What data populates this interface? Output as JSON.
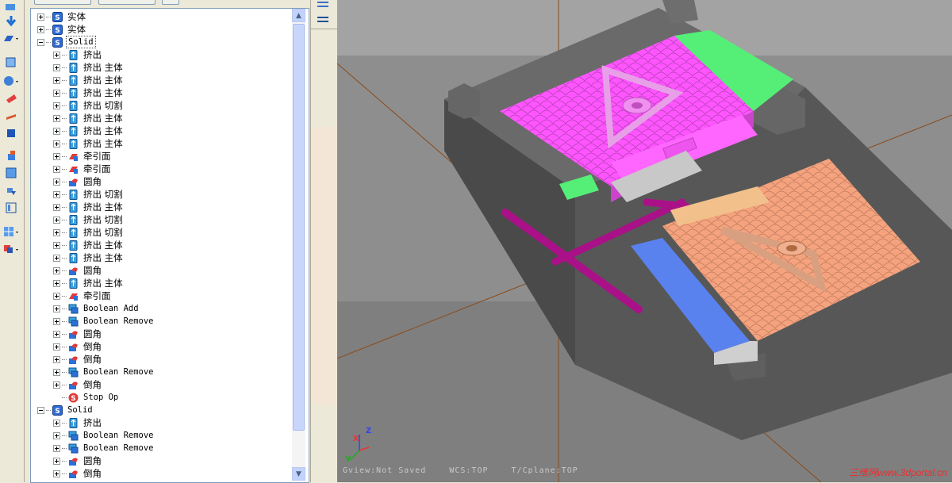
{
  "tree": {
    "items": [
      {
        "label": "实体",
        "kind": "solid",
        "level": 0,
        "expander": "plus"
      },
      {
        "label": "实体",
        "kind": "solid",
        "level": 0,
        "expander": "plus"
      },
      {
        "label": "Solid",
        "kind": "solid",
        "level": 0,
        "expander": "minus",
        "selected": true,
        "mono": true
      },
      {
        "label": "挤出",
        "kind": "extrude",
        "level": 1,
        "expander": "plus"
      },
      {
        "label": "挤出 主体",
        "kind": "extrude",
        "level": 1,
        "expander": "plus"
      },
      {
        "label": "挤出 主体",
        "kind": "extrude",
        "level": 1,
        "expander": "plus"
      },
      {
        "label": "挤出 主体",
        "kind": "extrude",
        "level": 1,
        "expander": "plus"
      },
      {
        "label": "挤出 切割",
        "kind": "extrude",
        "level": 1,
        "expander": "plus"
      },
      {
        "label": "挤出 主体",
        "kind": "extrude",
        "level": 1,
        "expander": "plus"
      },
      {
        "label": "挤出 主体",
        "kind": "extrude",
        "level": 1,
        "expander": "plus"
      },
      {
        "label": "挤出 主体",
        "kind": "extrude",
        "level": 1,
        "expander": "plus"
      },
      {
        "label": "牵引面",
        "kind": "draft",
        "level": 1,
        "expander": "plus"
      },
      {
        "label": "牵引面",
        "kind": "draft",
        "level": 1,
        "expander": "plus"
      },
      {
        "label": "圆角",
        "kind": "fillet",
        "level": 1,
        "expander": "plus"
      },
      {
        "label": "挤出 切割",
        "kind": "extrude",
        "level": 1,
        "expander": "plus"
      },
      {
        "label": "挤出 主体",
        "kind": "extrude",
        "level": 1,
        "expander": "plus"
      },
      {
        "label": "挤出 切割",
        "kind": "extrude",
        "level": 1,
        "expander": "plus"
      },
      {
        "label": "挤出 切割",
        "kind": "extrude",
        "level": 1,
        "expander": "plus"
      },
      {
        "label": "挤出 主体",
        "kind": "extrude",
        "level": 1,
        "expander": "plus"
      },
      {
        "label": "挤出 主体",
        "kind": "extrude",
        "level": 1,
        "expander": "plus"
      },
      {
        "label": "圆角",
        "kind": "fillet",
        "level": 1,
        "expander": "plus"
      },
      {
        "label": "挤出 主体",
        "kind": "extrude",
        "level": 1,
        "expander": "plus"
      },
      {
        "label": "牵引面",
        "kind": "draft",
        "level": 1,
        "expander": "plus"
      },
      {
        "label": "Boolean Add",
        "kind": "boolean",
        "level": 1,
        "expander": "plus",
        "mono": true
      },
      {
        "label": "Boolean Remove",
        "kind": "boolean",
        "level": 1,
        "expander": "plus",
        "mono": true
      },
      {
        "label": "圆角",
        "kind": "fillet",
        "level": 1,
        "expander": "plus"
      },
      {
        "label": "倒角",
        "kind": "fillet",
        "level": 1,
        "expander": "plus"
      },
      {
        "label": "倒角",
        "kind": "fillet",
        "level": 1,
        "expander": "plus"
      },
      {
        "label": "Boolean Remove",
        "kind": "boolean",
        "level": 1,
        "expander": "plus",
        "mono": true
      },
      {
        "label": "倒角",
        "kind": "fillet",
        "level": 1,
        "expander": "plus"
      },
      {
        "label": "Stop Op",
        "kind": "stop",
        "level": 1,
        "expander": "none",
        "mono": true
      },
      {
        "label": "Solid",
        "kind": "solid",
        "level": 0,
        "expander": "minus",
        "mono": true
      },
      {
        "label": "挤出",
        "kind": "extrude",
        "level": 1,
        "expander": "plus"
      },
      {
        "label": "Boolean Remove",
        "kind": "boolean",
        "level": 1,
        "expander": "plus",
        "mono": true
      },
      {
        "label": "Boolean Remove",
        "kind": "boolean",
        "level": 1,
        "expander": "plus",
        "mono": true
      },
      {
        "label": "圆角",
        "kind": "fillet",
        "level": 1,
        "expander": "plus"
      },
      {
        "label": "倒角",
        "kind": "fillet",
        "level": 1,
        "expander": "plus"
      }
    ]
  },
  "viewport": {
    "status_gview": "Gview:Not Saved",
    "status_wcs": "WCS:TOP",
    "status_tplane": "T/Cplane:TOP",
    "triad_x": "X",
    "triad_y": "Y",
    "triad_z": "Z",
    "watermark": "三维网www.3dportal.cn"
  },
  "colors": {
    "viewport_bg": "#8a8a8a",
    "mold_base": "#555555",
    "pink_insert": "#ff55ff",
    "orange_insert": "#f4a37e",
    "green_slide": "#55ee77",
    "blue_slide": "#5a82ee",
    "runner": "#aa1188"
  }
}
